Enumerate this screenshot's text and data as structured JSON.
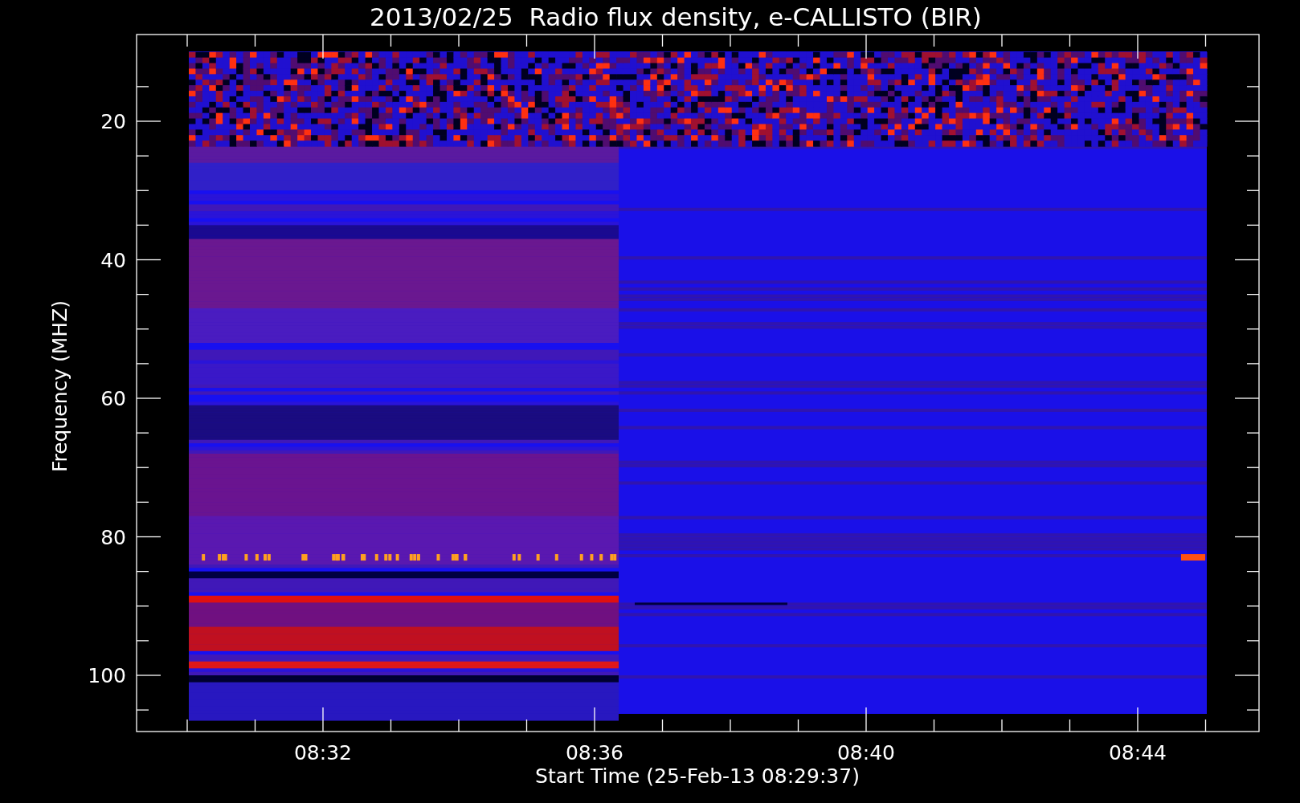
{
  "title": "2013/02/25  Radio flux density, e-CALLISTO (BIR)",
  "plot": {
    "ylabel": "Frequency (MHZ)",
    "xlabel": "Start Time (25-Feb-13 08:29:37)",
    "yticks": [
      "20",
      "40",
      "60",
      "80",
      "100"
    ],
    "xticks": [
      "08:32",
      "08:36",
      "08:40",
      "08:44"
    ]
  }
}
